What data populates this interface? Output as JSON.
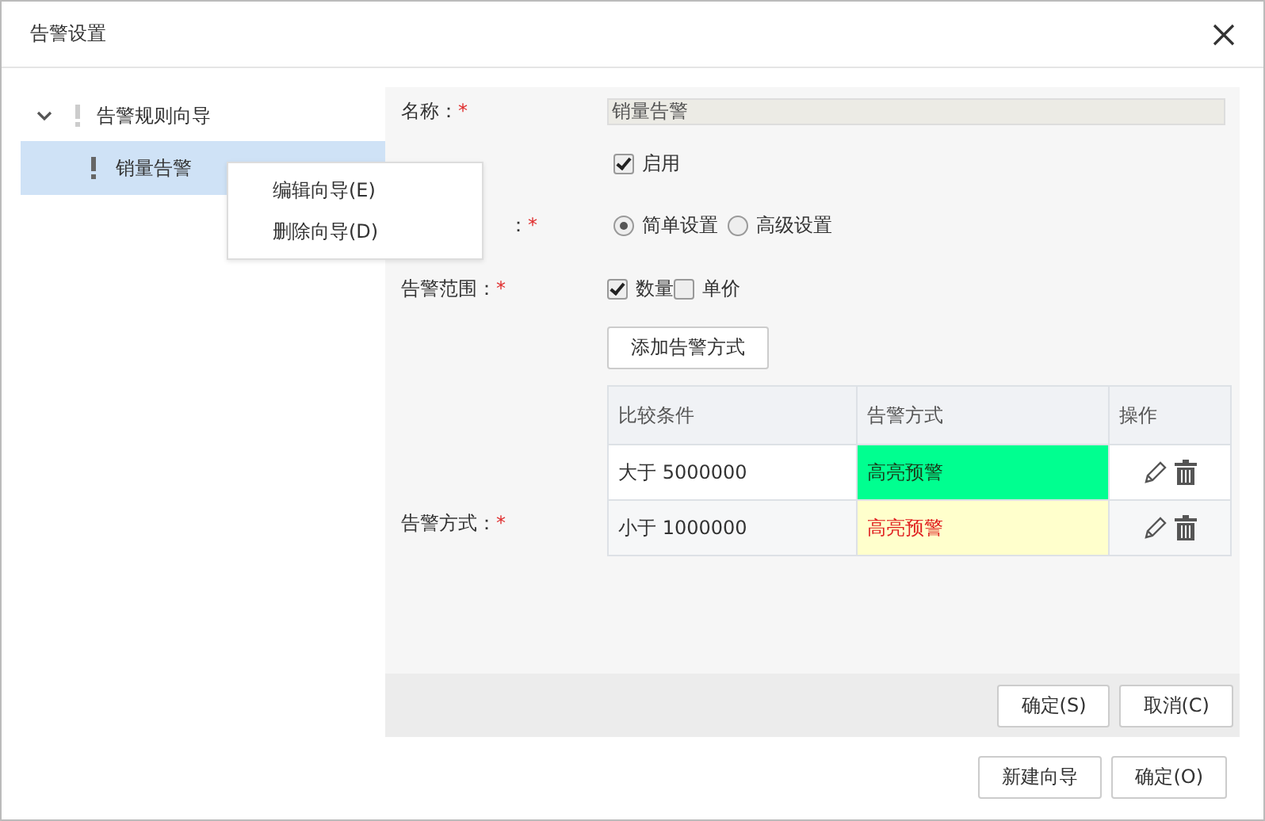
{
  "window": {
    "title": "告警设置"
  },
  "tree": [
    {
      "label": "告警规则向导",
      "expanded": true,
      "selected": false,
      "children": [
        {
          "label": "销量告警",
          "selected": true
        }
      ]
    }
  ],
  "context_menu": [
    "编辑向导(E)",
    "删除向导(D)"
  ],
  "form": {
    "name": {
      "label": "名称：",
      "required_mark": "*",
      "value": "销量告警"
    },
    "enabled": {
      "option": "启用",
      "checked": true
    },
    "mode": {
      "label": "：",
      "required_mark": "*",
      "options": [
        {
          "label": "简单设置",
          "selected": true
        },
        {
          "label": "高级设置",
          "selected": false
        }
      ]
    },
    "scope": {
      "label": "告警范围：",
      "required_mark": "*",
      "options": [
        {
          "label": "数量",
          "checked": true
        },
        {
          "label": "单价",
          "checked": false
        }
      ]
    },
    "add_button": "添加告警方式",
    "methods_label": {
      "label": "告警方式：",
      "required_mark": "*"
    }
  },
  "table": {
    "columns": [
      "比较条件",
      "告警方式",
      "操作"
    ],
    "rows": [
      {
        "condition": "大于 5000000",
        "style": "高亮预警",
        "color": "#00ff90",
        "kind": "normal"
      },
      {
        "condition": "小于 1000000",
        "style": "高亮预警",
        "color": "#ffffcc",
        "kind": "alert"
      }
    ]
  },
  "panel_buttons": [
    "确定(S)",
    "取消(C)"
  ],
  "footer_buttons": [
    "新建向导",
    "确定(O)"
  ]
}
